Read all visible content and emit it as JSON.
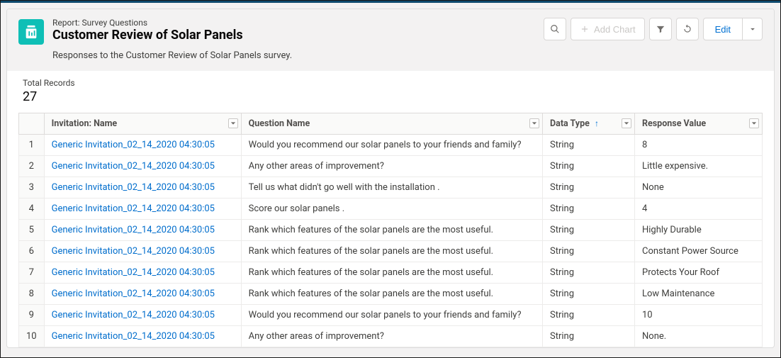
{
  "header": {
    "report_type": "Report: Survey Questions",
    "title": "Customer Review of Solar Panels",
    "subtitle": "Responses to the Customer Review of Solar Panels survey.",
    "add_chart_label": "Add Chart",
    "edit_label": "Edit"
  },
  "totals": {
    "label": "Total Records",
    "count": "27"
  },
  "columns": {
    "invitation": "Invitation: Name",
    "question": "Question Name",
    "datatype": "Data Type",
    "response": "Response Value"
  },
  "rows": [
    {
      "n": "1",
      "inv": "Generic Invitation_02_14_2020 04:30:05",
      "q": "Would you recommend our solar panels to your friends and family?",
      "dt": "String",
      "r": "8"
    },
    {
      "n": "2",
      "inv": "Generic Invitation_02_14_2020 04:30:05",
      "q": "Any other areas of improvement?",
      "dt": "String",
      "r": "Little expensive."
    },
    {
      "n": "3",
      "inv": "Generic Invitation_02_14_2020 04:30:05",
      "q": "Tell us what didn't go well with the installation .",
      "dt": "String",
      "r": "None"
    },
    {
      "n": "4",
      "inv": "Generic Invitation_02_14_2020 04:30:05",
      "q": "Score our solar panels .",
      "dt": "String",
      "r": "4"
    },
    {
      "n": "5",
      "inv": "Generic Invitation_02_14_2020 04:30:05",
      "q": "Rank which features of the solar panels are the most useful.",
      "dt": "String",
      "r": "Highly Durable"
    },
    {
      "n": "6",
      "inv": "Generic Invitation_02_14_2020 04:30:05",
      "q": "Rank which features of the solar panels are the most useful.",
      "dt": "String",
      "r": "Constant Power Source"
    },
    {
      "n": "7",
      "inv": "Generic Invitation_02_14_2020 04:30:05",
      "q": "Rank which features of the solar panels are the most useful.",
      "dt": "String",
      "r": "Protects Your Roof"
    },
    {
      "n": "8",
      "inv": "Generic Invitation_02_14_2020 04:30:05",
      "q": "Rank which features of the solar panels are the most useful.",
      "dt": "String",
      "r": "Low Maintenance"
    },
    {
      "n": "9",
      "inv": "Generic Invitation_02_14_2020 04:30:05",
      "q": "Would you recommend our solar panels to your friends and family?",
      "dt": "String",
      "r": "10"
    },
    {
      "n": "10",
      "inv": "Generic Invitation_02_14_2020 04:30:05",
      "q": "Any other areas of improvement?",
      "dt": "String",
      "r": "None."
    }
  ]
}
